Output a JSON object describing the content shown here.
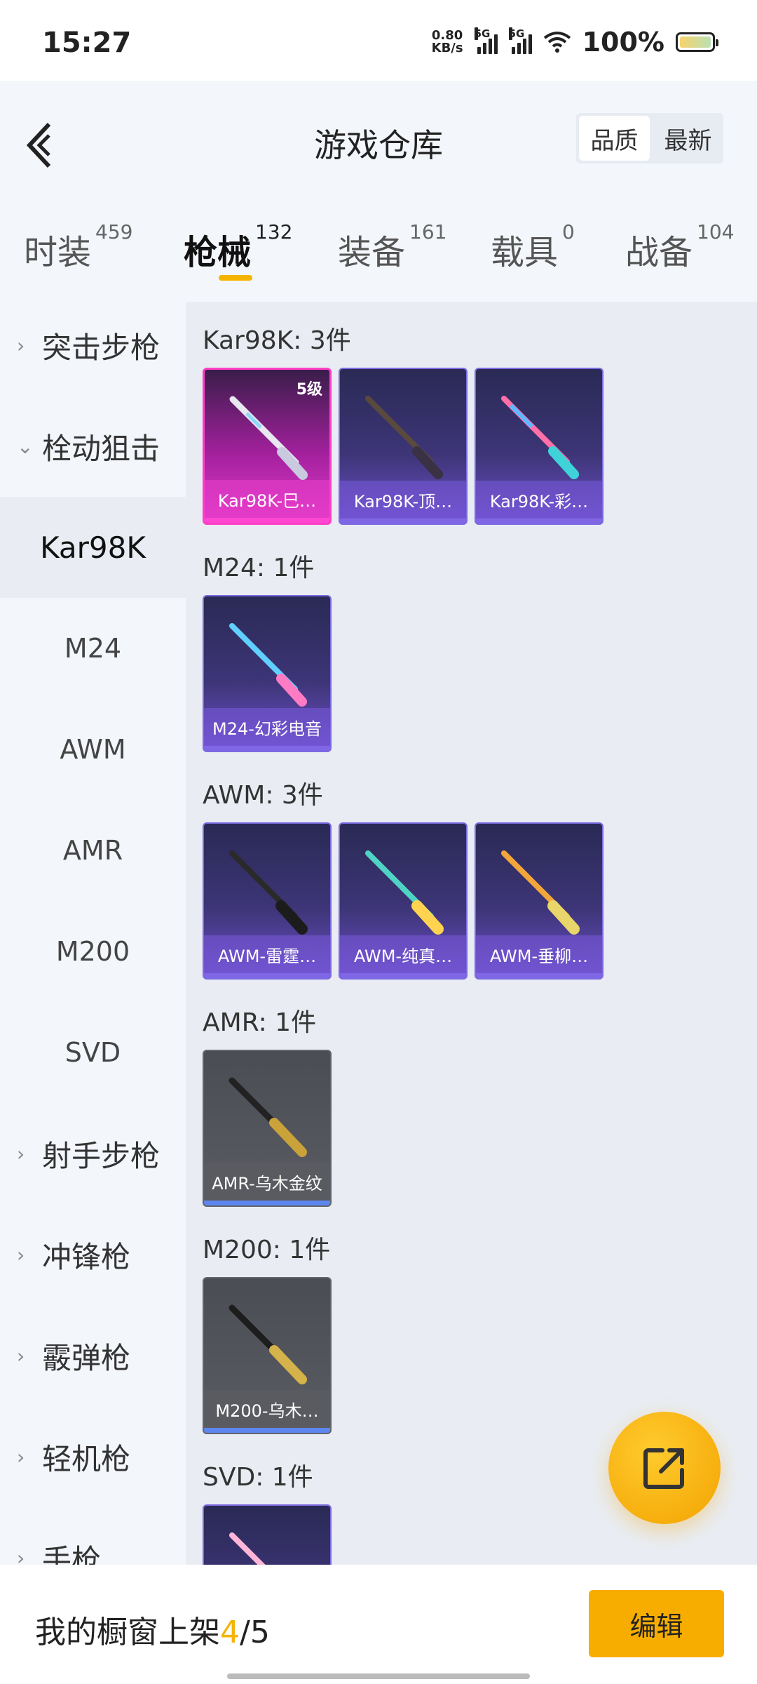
{
  "status_bar": {
    "time": "15:27",
    "speed_value": "0.80",
    "speed_unit": "KB/s",
    "net1": "5G",
    "net2": "5G",
    "battery": "100%"
  },
  "header": {
    "title": "游戏仓库",
    "sort_options": [
      "品质",
      "最新"
    ],
    "sort_selected": "品质"
  },
  "tabs": [
    {
      "label": "时装",
      "count": "459"
    },
    {
      "label": "枪械",
      "count": "132"
    },
    {
      "label": "装备",
      "count": "161"
    },
    {
      "label": "载具",
      "count": "0"
    },
    {
      "label": "战备",
      "count": "104"
    }
  ],
  "active_tab": "枪械",
  "sidebar": {
    "groups": [
      {
        "label": "突击步枪",
        "expanded": false
      },
      {
        "label": "栓动狙击",
        "expanded": true
      },
      {
        "label": "射手步枪",
        "expanded": false
      },
      {
        "label": "冲锋枪",
        "expanded": false
      },
      {
        "label": "霰弹枪",
        "expanded": false
      },
      {
        "label": "轻机枪",
        "expanded": false
      },
      {
        "label": "手枪",
        "expanded": false
      }
    ],
    "sub_items": [
      "Kar98K",
      "M24",
      "AWM",
      "AMR",
      "M200",
      "SVD"
    ],
    "active_sub": "Kar98K"
  },
  "sections": [
    {
      "title": "Kar98K: 3件",
      "items": [
        {
          "name": "Kar98K-巳…",
          "level": "5级",
          "rarity": "pink"
        },
        {
          "name": "Kar98K-顶…",
          "rarity": "purple"
        },
        {
          "name": "Kar98K-彩…",
          "rarity": "purple"
        }
      ]
    },
    {
      "title": "M24: 1件",
      "items": [
        {
          "name": "M24-幻彩电音",
          "rarity": "purple"
        }
      ]
    },
    {
      "title": "AWM: 3件",
      "items": [
        {
          "name": "AWM-雷霆…",
          "rarity": "purple"
        },
        {
          "name": "AWM-纯真…",
          "rarity": "purple"
        },
        {
          "name": "AWM-垂柳…",
          "rarity": "purple"
        }
      ]
    },
    {
      "title": "AMR: 1件",
      "items": [
        {
          "name": "AMR-乌木金纹",
          "rarity": "gray"
        }
      ]
    },
    {
      "title": "M200: 1件",
      "items": [
        {
          "name": "M200-乌木…",
          "rarity": "gray"
        }
      ]
    },
    {
      "title": "SVD: 1件",
      "items": [
        {
          "name": "",
          "rarity": "purple"
        }
      ]
    }
  ],
  "bottom_bar": {
    "label": "我的橱窗上架",
    "count": "4",
    "separator": "/",
    "total": "5",
    "edit": "编辑"
  },
  "colors": {
    "accent": "#f5b400",
    "rare_purple": "#6d4fc9",
    "rare_pink": "#e23ccb",
    "common_gray": "#5a5c63"
  },
  "icons": [
    "back-arrow-icon",
    "share-external-icon",
    "chevron-right-icon",
    "chevron-down-icon"
  ]
}
